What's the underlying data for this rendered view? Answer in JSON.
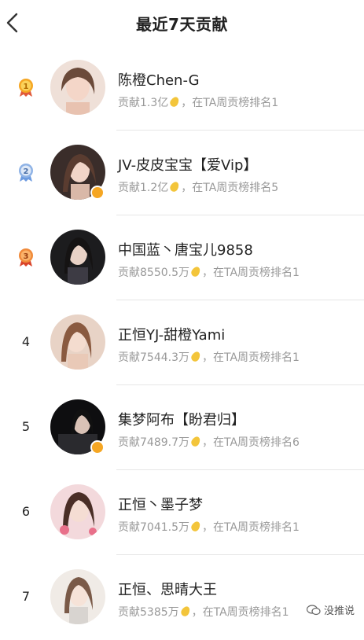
{
  "header": {
    "title": "最近7天贡献"
  },
  "rows": [
    {
      "rank": "1",
      "name": "陈橙Chen-G",
      "contribution": "贡献1.3亿",
      "rank_text": "，在TA周贡榜排名1",
      "medal_color": "#f5a623"
    },
    {
      "rank": "2",
      "name": "JV-皮皮宝宝【爱Vip】",
      "contribution": "贡献1.2亿",
      "rank_text": "，在TA周贡榜排名5",
      "medal_color": "#8fb3e6"
    },
    {
      "rank": "3",
      "name": "中国蓝丶唐宝儿9858",
      "contribution": "贡献8550.5万",
      "rank_text": "，在TA周贡榜排名1",
      "medal_color": "#f08a3a"
    },
    {
      "rank": "4",
      "name": "正恒YJ-甜橙Yami",
      "contribution": "贡献7544.3万",
      "rank_text": "，在TA周贡榜排名1"
    },
    {
      "rank": "5",
      "name": "集梦阿布【盼君归】",
      "contribution": "贡献7489.7万",
      "rank_text": "，在TA周贡榜排名6"
    },
    {
      "rank": "6",
      "name": "正恒丶墨子梦",
      "contribution": "贡献7041.5万",
      "rank_text": "，在TA周贡榜排名1"
    },
    {
      "rank": "7",
      "name": "正恒、思晴大王",
      "contribution": "贡献5385万",
      "rank_text": "，在TA周贡榜排名1"
    }
  ],
  "watermark": {
    "text": "没推说"
  }
}
